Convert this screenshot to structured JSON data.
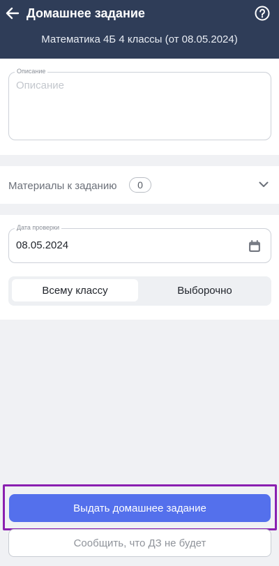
{
  "header": {
    "title": "Домашнее задание",
    "subtitle": "Математика 4Б 4 классы (от 08.05.2024)",
    "back_icon": "arrow-left-icon",
    "help_icon": "question-circle-icon"
  },
  "description": {
    "label": "Описание",
    "placeholder": "Описание",
    "value": ""
  },
  "materials": {
    "label": "Материалы к заданию",
    "count": "0",
    "icon": "chevron-down-icon"
  },
  "check_date": {
    "label": "Дата проверки",
    "value": "08.05.2024",
    "icon": "calendar-icon"
  },
  "audience": {
    "options": [
      "Всему классу",
      "Выборочно"
    ],
    "selected": "Всему классу"
  },
  "actions": {
    "primary_label": "Выдать домашнее задание",
    "secondary_label": "Сообщить, что ДЗ не будет"
  },
  "colors": {
    "header_bg": "#2f3d58",
    "primary": "#5470ec",
    "highlight": "#8a1fb0"
  }
}
